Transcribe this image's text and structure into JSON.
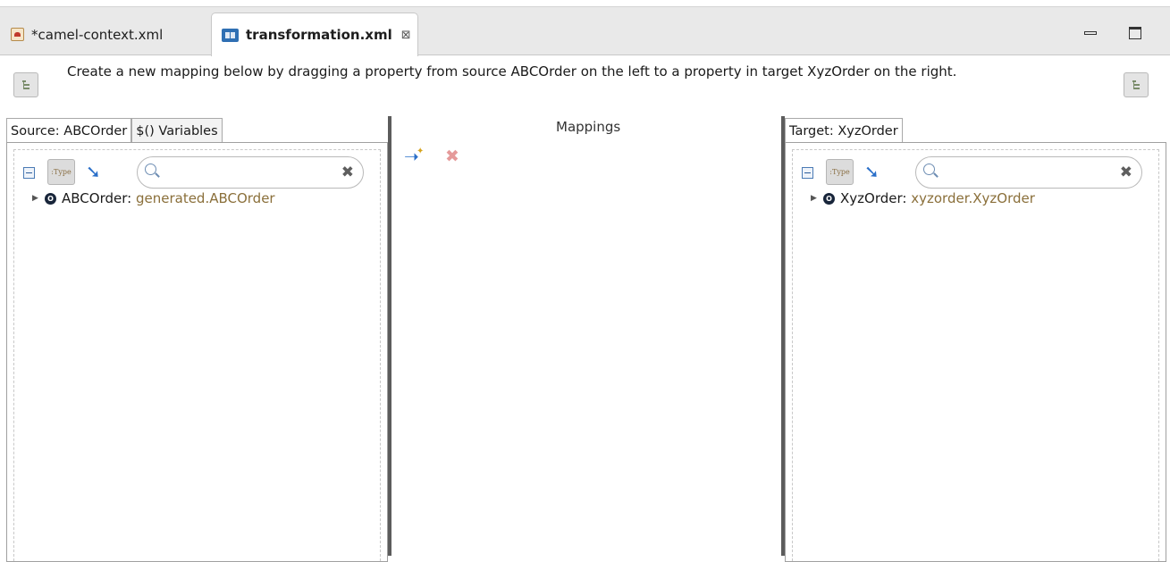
{
  "editor_tabs": [
    {
      "label": "*camel-context.xml",
      "icon": "camel-file-icon",
      "active": false
    },
    {
      "label": "transformation.xml",
      "icon": "transformation-icon",
      "active": true,
      "close": "⊠"
    }
  ],
  "instruction": "Create a new mapping below by dragging a property from source ABCOrder on the left to a property in target XyzOrder  on the right.",
  "source_pane": {
    "tabs": [
      {
        "label": "Source: ABCOrder",
        "active": true
      },
      {
        "label": "$() Variables",
        "active": false
      }
    ],
    "type_toggle": ":Type",
    "search": {
      "value": "",
      "placeholder": ""
    },
    "tree": {
      "name": "ABCOrder",
      "sep": ":",
      "type": "generated.ABCOrder"
    }
  },
  "mappings": {
    "title": "Mappings"
  },
  "target_pane": {
    "tabs": [
      {
        "label": "Target: XyzOrder",
        "active": true
      }
    ],
    "type_toggle": ":Type",
    "search": {
      "value": "",
      "placeholder": ""
    },
    "tree": {
      "name": "XyzOrder",
      "sep": ":",
      "type": "xyzorder.XyzOrder"
    }
  },
  "colors": {
    "accent_blue": "#2a6fc9",
    "type_text": "#8a6f3a",
    "delete_red": "#e59a9a"
  }
}
